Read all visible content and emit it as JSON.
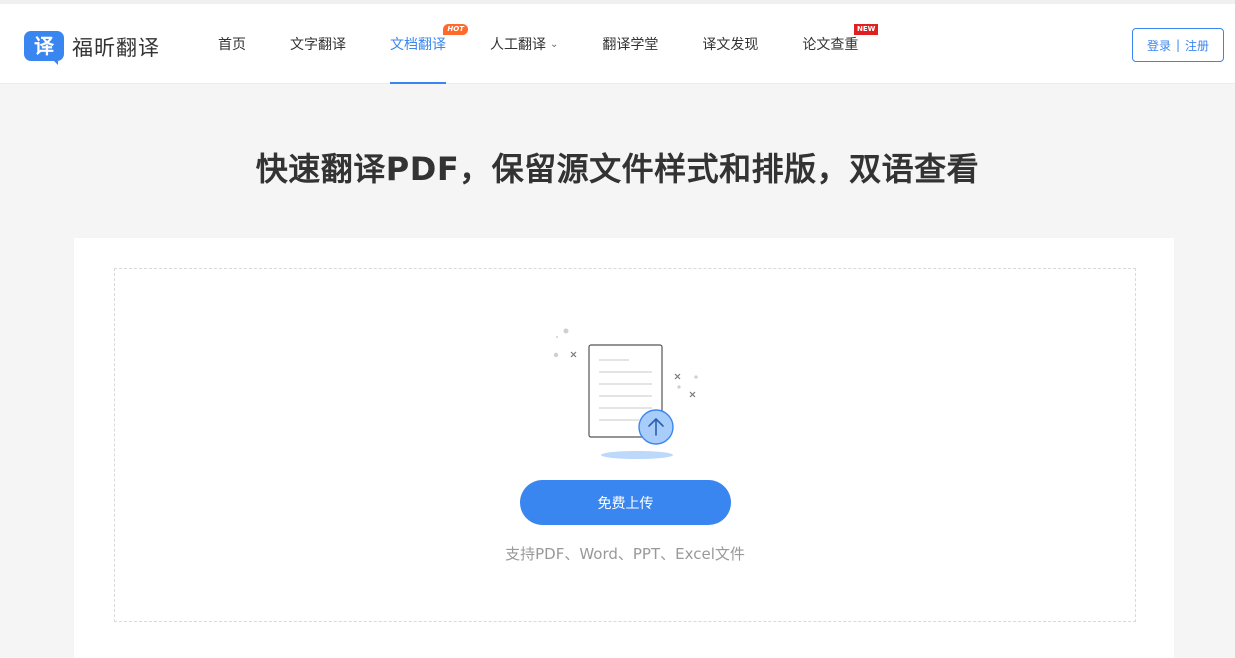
{
  "brand": {
    "logo_glyph": "译",
    "name": "福昕翻译",
    "color": "#3a86f0"
  },
  "nav": {
    "items": [
      {
        "label": "首页"
      },
      {
        "label": "文字翻译"
      },
      {
        "label": "文档翻译",
        "active": true,
        "badge": "HOT"
      },
      {
        "label": "人工翻译",
        "dropdown": true
      },
      {
        "label": "翻译学堂"
      },
      {
        "label": "译文发现"
      },
      {
        "label": "论文查重",
        "badge": "NEW"
      }
    ],
    "chevron": "⌄"
  },
  "auth": {
    "login": "登录",
    "separator": "|",
    "register": "注册"
  },
  "hero": {
    "title": "快速翻译PDF，保留源文件样式和排版，双语查看"
  },
  "upload": {
    "button_label": "免费上传",
    "supported_formats": "支持PDF、Word、PPT、Excel文件",
    "illustration_icon": "document-upload-icon"
  },
  "colors": {
    "accent": "#3a86f0",
    "hot_badge": "#ff6a2b",
    "new_badge": "#e02020",
    "background": "#f5f5f5"
  }
}
